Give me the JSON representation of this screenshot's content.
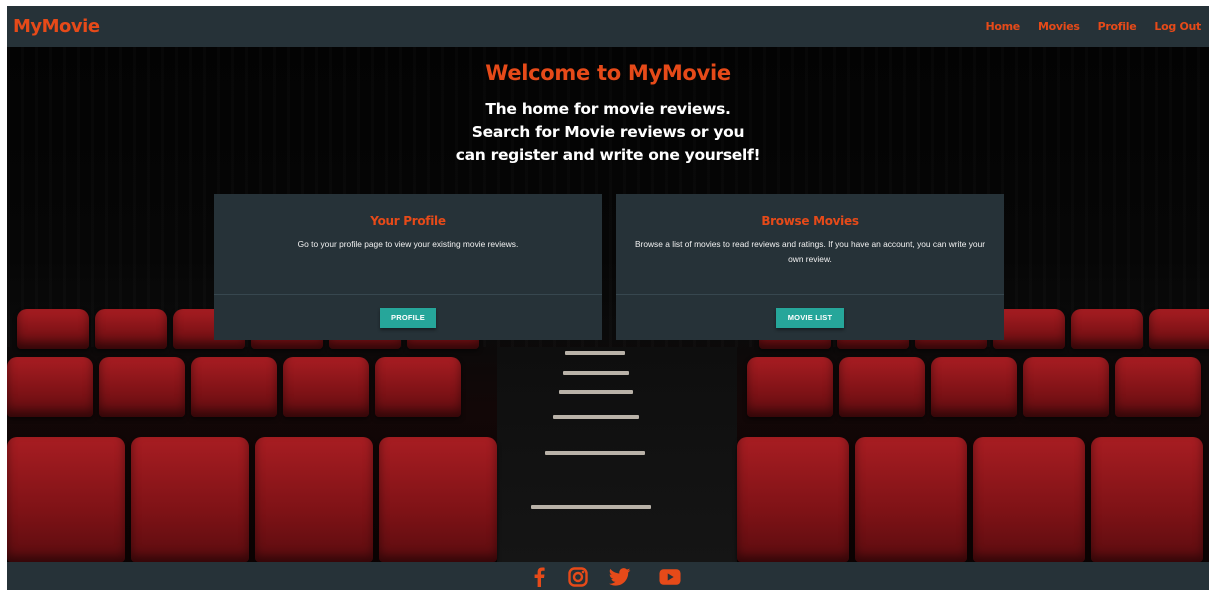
{
  "brand": "MyMovie",
  "nav": {
    "items": [
      {
        "label": "Home"
      },
      {
        "label": "Movies"
      },
      {
        "label": "Profile"
      },
      {
        "label": "Log Out"
      }
    ]
  },
  "hero": {
    "title": "Welcome to MyMovie",
    "intro_lines": [
      "The home for movie reviews.",
      "Search for Movie reviews or you",
      "can register and write one yourself!"
    ]
  },
  "cards": [
    {
      "title": "Your Profile",
      "text": "Go to your profile page to view your existing movie reviews.",
      "button": "PROFILE"
    },
    {
      "title": "Browse Movies",
      "text": "Browse a list of movies to read reviews and ratings. If you have an account, you can write your own review.",
      "button": "MOVIE LIST"
    }
  ],
  "footer": {
    "social_icons": [
      "facebook-icon",
      "instagram-icon",
      "twitter-icon",
      "youtube-icon"
    ]
  },
  "colors": {
    "accent": "#e64a19",
    "navbar": "#263238",
    "button": "#26a69a",
    "seat_red": "#a81d22"
  }
}
